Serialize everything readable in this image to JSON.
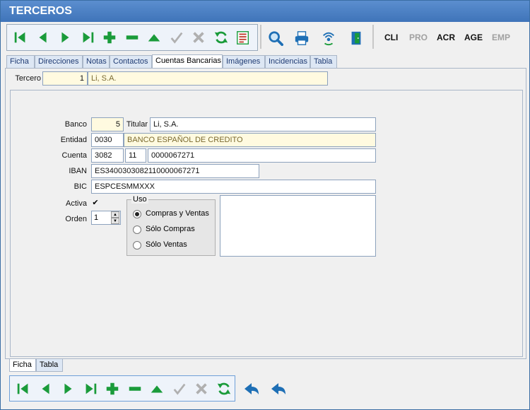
{
  "window": {
    "title": "TERCEROS"
  },
  "toolbar": {
    "buttons": [
      {
        "name": "first-icon",
        "color": "#1a9b3a"
      },
      {
        "name": "prev-icon",
        "color": "#1a9b3a"
      },
      {
        "name": "next-icon",
        "color": "#1a9b3a"
      },
      {
        "name": "last-icon",
        "color": "#1a9b3a"
      },
      {
        "name": "add-icon",
        "color": "#1a9b3a"
      },
      {
        "name": "delete-icon",
        "color": "#1a9b3a"
      },
      {
        "name": "edit-icon",
        "color": "#1a9b3a"
      },
      {
        "name": "confirm-icon",
        "color": "#b0b0b0"
      },
      {
        "name": "cancel-icon",
        "color": "#b0b0b0"
      },
      {
        "name": "refresh-icon",
        "color": "#1a9b3a"
      },
      {
        "name": "report-icon",
        "color": "#c0392b"
      }
    ],
    "extra": [
      "search-icon",
      "print-icon",
      "wireless-icon",
      "exit-door-icon"
    ]
  },
  "modules": [
    {
      "label": "CLI",
      "enabled": true
    },
    {
      "label": "PRO",
      "enabled": false
    },
    {
      "label": "ACR",
      "enabled": true
    },
    {
      "label": "AGE",
      "enabled": true
    },
    {
      "label": "EMP",
      "enabled": false
    }
  ],
  "tabs": [
    {
      "label": "Ficha",
      "active": false
    },
    {
      "label": "Direcciones",
      "active": false
    },
    {
      "label": "Notas",
      "active": false
    },
    {
      "label": "Contactos",
      "active": false
    },
    {
      "label": "Cuentas Bancarias",
      "active": true
    },
    {
      "label": "Imágenes",
      "active": false
    },
    {
      "label": "Incidencias",
      "active": false
    },
    {
      "label": "Tabla",
      "active": false
    }
  ],
  "tercero": {
    "label": "Tercero",
    "code": "1",
    "name": "Li, S.A."
  },
  "form": {
    "banco": {
      "label": "Banco",
      "value": "5"
    },
    "titular": {
      "label": "Titular",
      "value": "Li, S.A."
    },
    "entidad": {
      "label": "Entidad",
      "code": "0030",
      "name": "BANCO ESPAÑOL DE CREDITO"
    },
    "cuenta": {
      "label": "Cuenta",
      "office": "3082",
      "dc": "11",
      "number": "0000067271"
    },
    "iban": {
      "label": "IBAN",
      "value": "ES3400303082110000067271"
    },
    "bic": {
      "label": "BIC",
      "value": "ESPCESMMXXX"
    },
    "activa": {
      "label": "Activa",
      "checked": true,
      "mark": "✔"
    },
    "orden": {
      "label": "Orden",
      "value": "1"
    },
    "uso": {
      "label": "Uso",
      "options": [
        {
          "label": "Compras y Ventas",
          "selected": true
        },
        {
          "label": "Sólo Compras",
          "selected": false
        },
        {
          "label": "Sólo Ventas",
          "selected": false
        }
      ]
    }
  },
  "bottom_tabs": [
    {
      "label": "Ficha",
      "active": true
    },
    {
      "label": "Tabla",
      "active": false
    }
  ],
  "bottom_toolbar": {
    "buttons": [
      "first-icon",
      "prev-icon",
      "next-icon",
      "last-icon",
      "add-icon",
      "delete-icon",
      "edit-icon",
      "confirm-icon",
      "cancel-icon",
      "refresh-icon"
    ],
    "extra": [
      "back-icon",
      "undo-icon"
    ]
  }
}
